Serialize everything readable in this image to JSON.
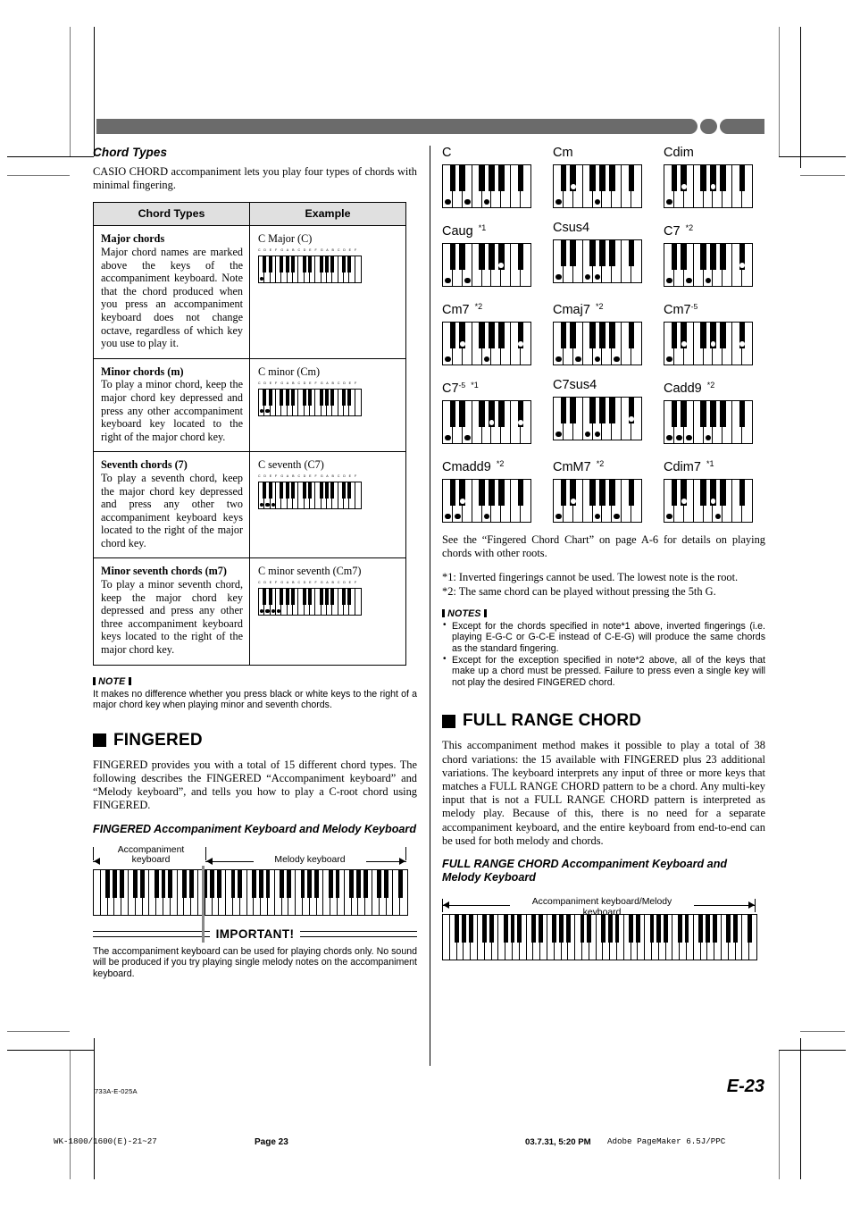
{
  "left": {
    "section_title": "Chord Types",
    "intro": "CASIO CHORD accompaniment lets you play four types of chords with minimal fingering.",
    "table": {
      "headers": [
        "Chord Types",
        "Example"
      ],
      "rows": [
        {
          "title": "Major chords",
          "text": "Major chord names are marked above the keys of the accompaniment keyboard. Note that the chord produced when you press an accompaniment keyboard does not change octave, regardless of which key you use to play it.",
          "example_label": "C Major (C)",
          "key_names": "C D E F G A B C D E F G A B C D E F",
          "pressed": [
            0
          ]
        },
        {
          "title": "Minor chords (m)",
          "text": "To play a minor chord, keep the major chord key depressed and press any other accompaniment keyboard key located to the right of the major chord key.",
          "example_label": "C minor (Cm)",
          "key_names": "C D E F G A B C D E F G A B C D E F",
          "pressed": [
            0,
            1
          ]
        },
        {
          "title": "Seventh chords (7)",
          "text": "To play a seventh chord, keep the major chord key depressed and press any other two accompaniment keyboard keys located to the right of the major chord key.",
          "example_label": "C seventh (C7)",
          "key_names": "C D E F G A B C D E F G A B C D E F",
          "pressed": [
            0,
            1,
            2
          ]
        },
        {
          "title": "Minor seventh chords (m7)",
          "text": "To play a minor seventh chord, keep the major chord key depressed and press any other three accompaniment keyboard keys located to the right of the major chord key.",
          "example_label": "C minor seventh (Cm7)",
          "key_names": "C D E F G A B C D E F G A B C D E F",
          "pressed": [
            0,
            1,
            2,
            3
          ]
        }
      ]
    },
    "note_heading": "NOTE",
    "note_body": "It makes no difference whether you press black or white keys to the right of a major chord key when playing minor and seventh chords.",
    "fingered_heading": "FINGERED",
    "fingered_body": "FINGERED provides you with a total of 15 different chord types. The following describes the FINGERED  “Accompaniment keyboard” and “Melody keyboard”, and tells you how to play a C-root chord using FINGERED.",
    "fingered_sub": "FINGERED Accompaniment Keyboard and Melody Keyboard",
    "kb_label_accomp": "Accompaniment keyboard",
    "kb_label_melody": "Melody keyboard",
    "important_title": "IMPORTANT!",
    "important_body": "The accompaniment keyboard can be used for playing chords only. No sound will be produced if you try playing single melody notes on the accompaniment keyboard."
  },
  "right": {
    "chords": [
      {
        "name": "C",
        "sup": "",
        "star": "",
        "black_dots": [],
        "white_dots": [
          0,
          2,
          4
        ]
      },
      {
        "name": "Cm",
        "sup": "",
        "star": "",
        "black_dots": [
          1
        ],
        "white_dots": [
          0,
          4
        ]
      },
      {
        "name": "Cdim",
        "sup": "",
        "star": "",
        "black_dots": [
          1,
          3
        ],
        "white_dots": [
          0
        ]
      },
      {
        "name": "Caug",
        "sup": "",
        "star": "*1",
        "black_dots": [
          4
        ],
        "white_dots": [
          0,
          2
        ]
      },
      {
        "name": "Csus4",
        "sup": "",
        "star": "",
        "black_dots": [],
        "white_dots": [
          0,
          3,
          4
        ]
      },
      {
        "name": "C7",
        "sup": "",
        "star": "*2",
        "black_dots": [
          5
        ],
        "white_dots": [
          0,
          2,
          4
        ]
      },
      {
        "name": "Cm7",
        "sup": "",
        "star": "*2",
        "black_dots": [
          1,
          5
        ],
        "white_dots": [
          0,
          4
        ]
      },
      {
        "name": "Cmaj7",
        "sup": "",
        "star": "*2",
        "black_dots": [],
        "white_dots": [
          0,
          2,
          4,
          6
        ]
      },
      {
        "name": "Cm7",
        "sup": "-5",
        "star": "",
        "black_dots": [
          1,
          3,
          5
        ],
        "white_dots": [
          0
        ]
      },
      {
        "name": "C7",
        "sup": "-5",
        "star": "*1",
        "black_dots": [
          3,
          5
        ],
        "white_dots": [
          0,
          2
        ]
      },
      {
        "name": "C7sus4",
        "sup": "",
        "star": "",
        "black_dots": [
          5
        ],
        "white_dots": [
          0,
          3,
          4
        ]
      },
      {
        "name": "Cadd9",
        "sup": "",
        "star": "*2",
        "black_dots": [],
        "white_dots": [
          0,
          1,
          2,
          4
        ]
      },
      {
        "name": "Cmadd9",
        "sup": "",
        "star": "*2",
        "black_dots": [
          1
        ],
        "white_dots": [
          0,
          1,
          4
        ]
      },
      {
        "name": "CmM7",
        "sup": "",
        "star": "*2",
        "black_dots": [
          1
        ],
        "white_dots": [
          0,
          4,
          6
        ]
      },
      {
        "name": "Cdim7",
        "sup": "",
        "star": "*1",
        "black_dots": [
          1,
          3
        ],
        "white_dots": [
          0,
          5
        ]
      }
    ],
    "see_also": "See the “Fingered Chord Chart” on page A-6 for details on playing chords with other roots.",
    "footnote1": "*1: Inverted fingerings cannot be used. The lowest note is the root.",
    "footnote2": "*2: The same chord can be played without pressing the 5th G.",
    "notes_heading": "NOTES",
    "notes": [
      "Except for the chords specified in note*1 above, inverted fingerings (i.e. playing E-G-C or G-C-E instead of C-E-G) will produce the same chords as the standard fingering.",
      "Except for the exception specified in note*2 above, all of the keys that make up a chord must be pressed. Failure to press even a single key will not play the desired FINGERED chord."
    ],
    "frc_heading": "FULL RANGE CHORD",
    "frc_body": "This accompaniment method makes it possible to play a total of 38 chord variations: the 15 available with FINGERED plus 23 additional variations. The keyboard interprets any input of three or more keys that matches a FULL RANGE CHORD pattern to be a chord. Any multi-key input that is not a FULL RANGE CHORD pattern is interpreted as melody play. Because of this, there is no need for a separate accompaniment keyboard, and the entire keyboard from end-to-end can be used for both melody and chords.",
    "frc_sub": "FULL RANGE CHORD Accompaniment Keyboard and Melody Keyboard",
    "frc_kb_label": "Accompaniment keyboard/Melody keyboard"
  },
  "footer": {
    "doc_code": "733A-E-025A",
    "page_label": "E-23",
    "print_file": "WK-1800/1600(E)-21~27",
    "print_page": "Page 23",
    "print_date": "03.7.31, 5:20 PM",
    "print_app": "Adobe PageMaker 6.5J/PPC"
  },
  "colors": {
    "header_bar": "#6b6b6b",
    "table_header_bg": "#e0e0e0",
    "ink": "#000000"
  }
}
